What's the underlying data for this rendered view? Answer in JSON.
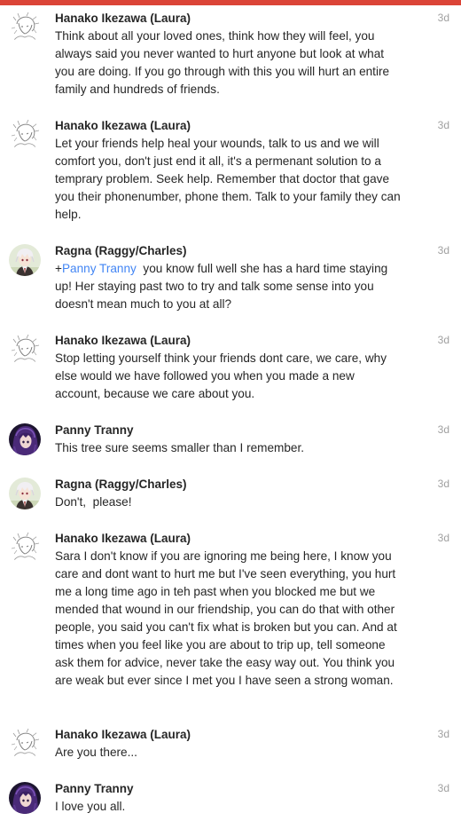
{
  "comments": [
    {
      "author": "Hanako Ikezawa (Laura)",
      "avatar": "sketch-avatar",
      "time": "3d",
      "text": "Think about all your loved ones, think how they will feel, you always said you never wanted to hurt anyone but look at what you are doing. If you go through with this you will hurt an entire family and hundreds of friends."
    },
    {
      "author": "Hanako Ikezawa (Laura)",
      "avatar": "sketch-avatar",
      "time": "3d",
      "text": "Let your friends help heal your wounds, talk to us and we will comfort you, don't just end it all, it's a permenant solution to a temprary problem. Seek help. Remember that doctor that gave you their phonenumber, phone them. Talk to your family they can help."
    },
    {
      "author": "Ragna (Raggy/Charles)",
      "avatar": "anime-white-hair-avatar",
      "time": "3d",
      "mention_prefix": "+",
      "mention": "Panny Tranny",
      "text": "  you know full well she has a hard time staying up! Her staying past two to try and talk some sense into you doesn't mean much to you at all?"
    },
    {
      "author": "Hanako Ikezawa (Laura)",
      "avatar": "sketch-avatar",
      "time": "3d",
      "text": "Stop letting yourself think your friends dont care, we care, why else would we have followed you when you made a new account, because we care about you."
    },
    {
      "author": "Panny Tranny",
      "avatar": "purple-hair-avatar",
      "time": "3d",
      "text": "This tree sure seems smaller than I remember."
    },
    {
      "author": "Ragna (Raggy/Charles)",
      "avatar": "anime-white-hair-avatar",
      "time": "3d",
      "text": "Don't,  please!"
    },
    {
      "author": "Hanako Ikezawa (Laura)",
      "avatar": "sketch-avatar",
      "time": "3d",
      "text": "Sara I don't know if you are ignoring me being here, I know you care and dont want to hurt me but I've seen everything, you hurt me a long time ago in teh past when you blocked me but we mended that wound in our friendship, you can do that with other people, you said you can't fix what is broken but you can. And at times when you feel like you are about to trip up, tell someone ask them for advice, never take the easy way out. You think you are weak but ever since I met you I have seen a strong woman."
    },
    {
      "author": "Hanako Ikezawa (Laura)",
      "avatar": "sketch-avatar",
      "time": "3d",
      "text": "Are you there..."
    },
    {
      "author": "Panny Tranny",
      "avatar": "purple-hair-avatar",
      "time": "3d",
      "text": "I love you all."
    }
  ],
  "colors": {
    "top_bar": "#db4437",
    "mention": "#4285f4",
    "text": "#262626",
    "timestamp": "#a0a0a0"
  }
}
